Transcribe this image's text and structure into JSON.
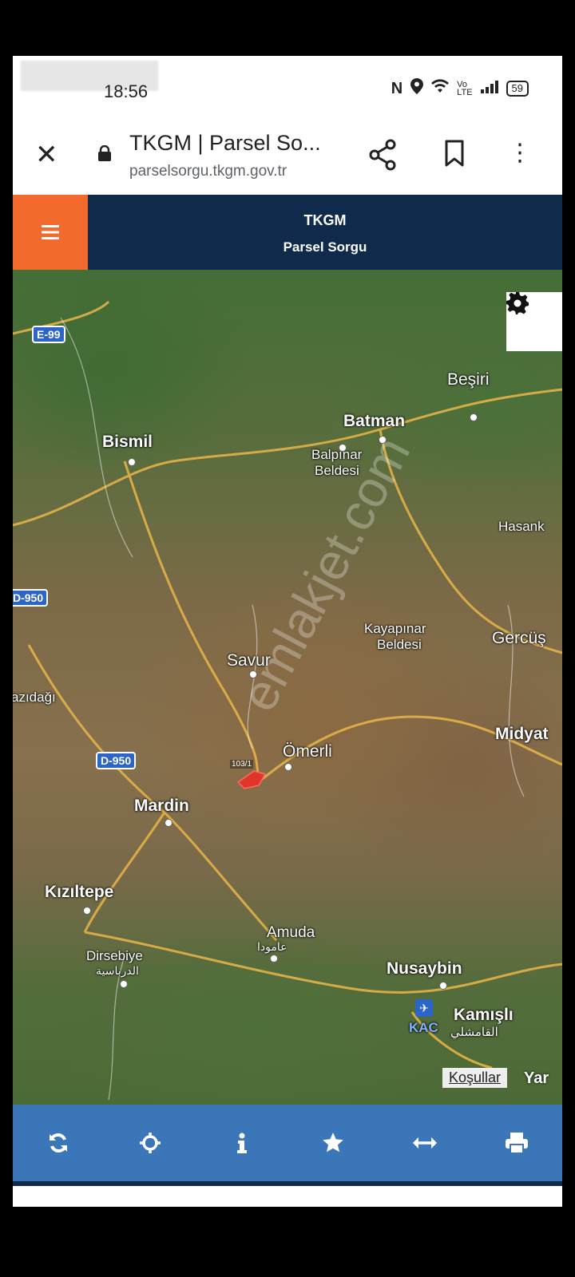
{
  "status_bar": {
    "time": "18:56",
    "battery": "59",
    "icons": [
      "nfc-icon",
      "location-icon",
      "wifi-icon",
      "volte-icon",
      "signal-icon",
      "battery-icon"
    ]
  },
  "browser": {
    "title": "TKGM | Parsel So...",
    "url": "parselsorgu.tkgm.gov.tr"
  },
  "app_header": {
    "title": "TKGM",
    "subtitle": "Parsel Sorgu"
  },
  "map": {
    "places": {
      "batman": "Batman",
      "besiri": "Beşiri",
      "bismil": "Bismil",
      "balpinar": "Balpınar",
      "beldesi1": "Beldesi",
      "hasank": "Hasank",
      "kayapinar": "Kayapınar",
      "beldesi2": "Beldesi",
      "gercus": "Gercüş",
      "savur": "Savur",
      "kiziltepe_partial": "azıdağı",
      "midyat": "Midyat",
      "omerli": "Ömerli",
      "mardin": "Mardin",
      "kiziltepe": "Kızıltepe",
      "amuda": "Amuda",
      "amuda_ar": "عامودا",
      "dirsebiye": "Dirsebiye",
      "dirsebiye_ar": "الدرباسية",
      "nusaybin": "Nusaybin",
      "kamisli": "Kamışlı",
      "kamisli_ar": "القامشلي",
      "kac": "KAC"
    },
    "road_shields": {
      "e99": "E-99",
      "d950_a": "D-950",
      "d950_b": "D-950"
    },
    "parcel_label": "103/1",
    "watermark": "emlakjet.com",
    "terms": "Koşullar",
    "edge_label": "Yar",
    "colors": {
      "parcel": "#e0352b",
      "road": "#e3b248",
      "shield": "#2d64c8"
    }
  },
  "bottom_toolbar": [
    "refresh-icon",
    "locate-icon",
    "info-icon",
    "star-icon",
    "measure-icon",
    "print-icon"
  ],
  "theme": {
    "header_bg": "#0f2a4a",
    "menu_bg": "#f26b2d",
    "toolbar_bg": "#3b76b8"
  }
}
